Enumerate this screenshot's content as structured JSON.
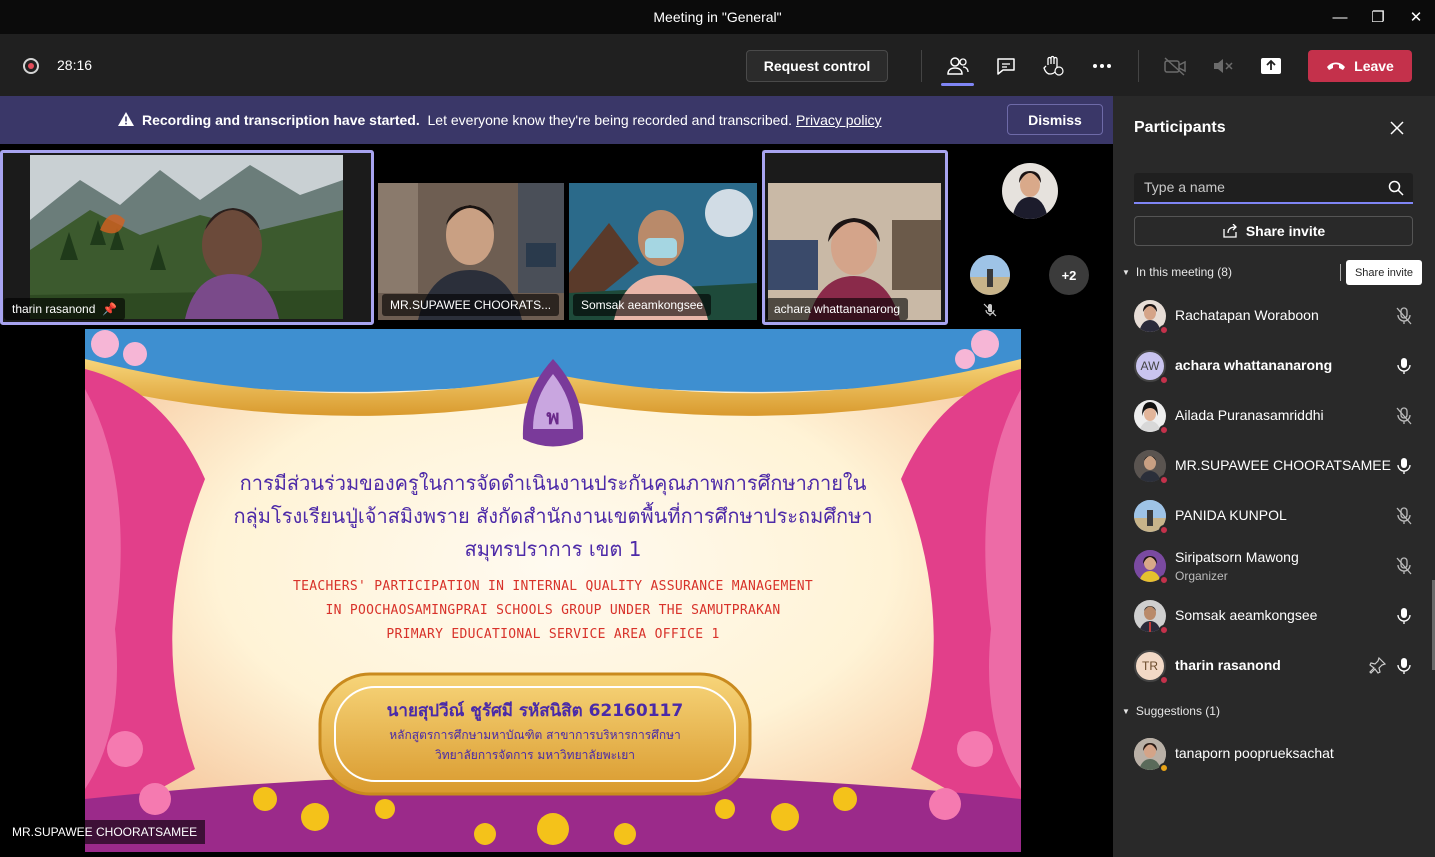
{
  "window": {
    "title": "Meeting in \"General\"",
    "minimize_glyph": "—",
    "maximize_glyph": "❐",
    "close_glyph": "✕"
  },
  "toolbar": {
    "timer": "28:16",
    "request_control": "Request control",
    "leave": "Leave",
    "icons": [
      "people-icon",
      "chat-icon",
      "reactions-icon",
      "more-icon",
      "camera-off-icon",
      "mic-off-icon",
      "share-screen-icon"
    ]
  },
  "banner": {
    "bold_text": "Recording and transcription have started.",
    "text": "Let everyone know they're being recorded and transcribed.",
    "link": "Privacy policy",
    "dismiss": "Dismiss"
  },
  "video_tiles": [
    {
      "name": "tharin rasanond",
      "pinned": true,
      "speaking": true
    },
    {
      "name": "MR.SUPAWEE CHOORATS...",
      "speaking": false
    },
    {
      "name": "Somsak aeamkongsee",
      "speaking": false
    },
    {
      "name": "achara whattananarong",
      "speaking": true
    }
  ],
  "overflow": {
    "count": "+2"
  },
  "slide": {
    "thai_title_line1": "การมีส่วนร่วมของครูในการจัดดำเนินงานประกันคุณภาพการศึกษาภายใน",
    "thai_title_line2": "กลุ่มโรงเรียนปู่เจ้าสมิงพราย สังกัดสำนักงานเขตพื้นที่การศึกษาประถมศึกษา",
    "thai_title_line3": "สมุทรปราการ เขต 1",
    "en_line1": "TEACHERS' PARTICIPATION IN INTERNAL QUALITY ASSURANCE MANAGEMENT",
    "en_line2": "IN POOCHAOSAMINGPRAI SCHOOLS GROUP UNDER THE SAMUTPRAKAN",
    "en_line3": "PRIMARY EDUCATIONAL SERVICE AREA OFFICE 1",
    "author": "นายสุปวีณ์  ชูรัศมี รหัสนิสิต 62160117",
    "program": "หลักสูตรการศึกษามหาบัณฑิต สาขาการบริหารการศึกษา",
    "college": "วิทยาลัยการจัดการ  มหาวิทยาลัยพะเยา"
  },
  "presenter_label": "MR.SUPAWEE CHOORATSAMEE",
  "panel": {
    "title": "Participants",
    "search_placeholder": "Type a name",
    "share_invite": "Share invite",
    "tooltip": "Share invite",
    "in_meeting": "In this meeting (8)",
    "suggestions": "Suggestions (1)",
    "participants": [
      {
        "name": "Rachatapan Woraboon",
        "role": "",
        "mic": "muted",
        "bold": false
      },
      {
        "name": "achara whattananarong",
        "role": "",
        "mic": "on",
        "bold": true,
        "initials": "AW"
      },
      {
        "name": "Ailada Puranasamriddhi",
        "role": "",
        "mic": "muted",
        "bold": false
      },
      {
        "name": "MR.SUPAWEE CHOORATSAMEE",
        "role": "",
        "mic": "on",
        "bold": false
      },
      {
        "name": "PANIDA KUNPOL",
        "role": "",
        "mic": "muted",
        "bold": false
      },
      {
        "name": "Siripatsorn Mawong",
        "role": "Organizer",
        "mic": "muted",
        "bold": false
      },
      {
        "name": "Somsak aeamkongsee",
        "role": "",
        "mic": "on",
        "bold": false
      },
      {
        "name": "tharin rasanond",
        "role": "",
        "mic": "on",
        "bold": true,
        "initials": "TR",
        "pinned": true
      }
    ],
    "suggested": [
      {
        "name": "tanaporn pooprueksachat"
      }
    ]
  },
  "colors": {
    "accent": "#7f85f5",
    "leave": "#c4314b",
    "banner": "#3a3768",
    "panel": "#292929"
  }
}
